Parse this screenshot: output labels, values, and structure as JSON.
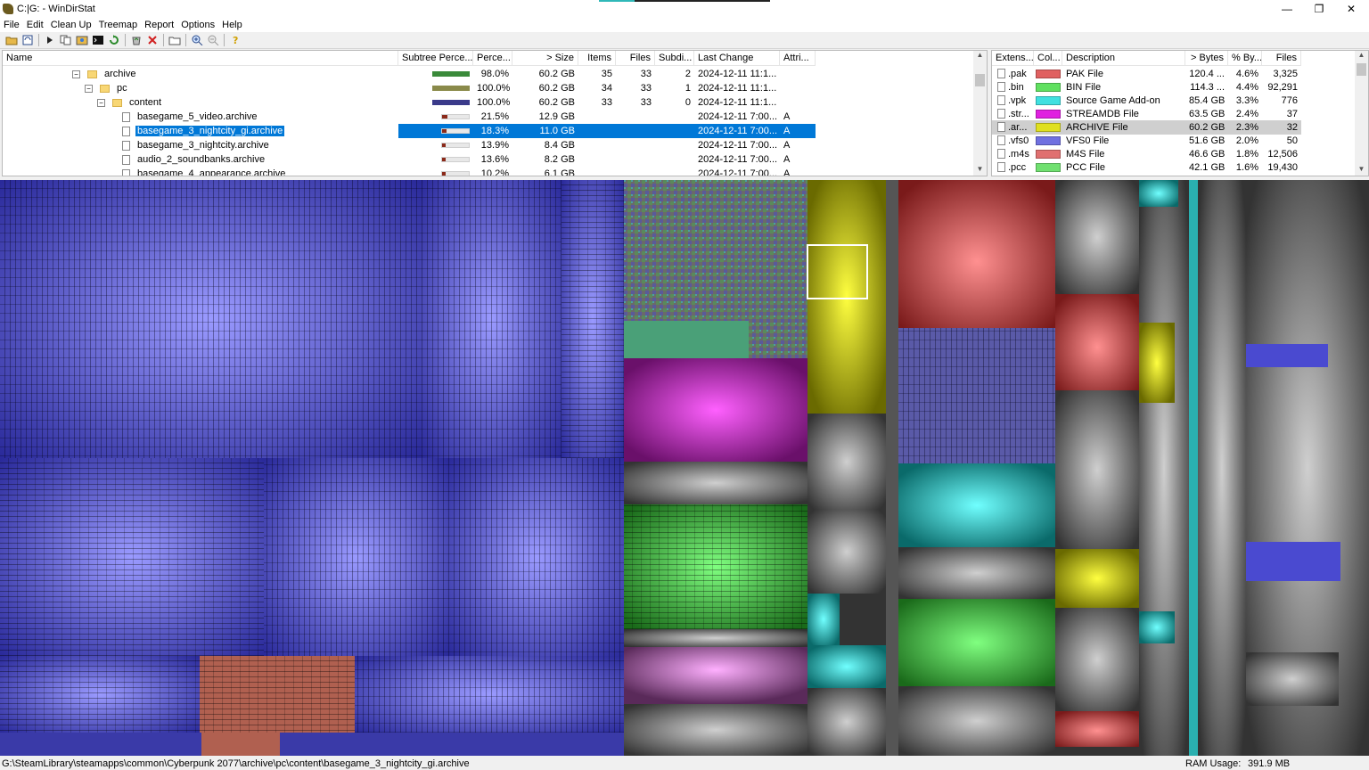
{
  "window": {
    "title": "C:|G: - WinDirStat",
    "minimize": "—",
    "maximize": "❐",
    "close": "✕"
  },
  "menu": [
    "File",
    "Edit",
    "Clean Up",
    "Treemap",
    "Report",
    "Options",
    "Help"
  ],
  "toolbar": {
    "icons": [
      "open-icon",
      "refresh-all-icon",
      "play-icon",
      "copy-path-icon",
      "explorer-icon",
      "command-prompt-icon",
      "refresh-icon",
      "recycle-icon",
      "delete-icon",
      "new-folder-icon",
      "zoom-in-icon",
      "zoom-out-icon",
      "help-icon"
    ]
  },
  "tree": {
    "headers": [
      "Name",
      "Subtree Perce...",
      "Perce...",
      "> Size",
      "Items",
      "Files",
      "Subdi...",
      "Last Change",
      "Attri..."
    ],
    "rows": [
      {
        "name": "archive",
        "type": "folder",
        "expander": "⊟",
        "indent": 0,
        "percent": "98.0%",
        "size": "60.2 GB",
        "items": "35",
        "files": "33",
        "subdirs": "2",
        "changed": "2024-12-11  11:1...",
        "attr": "",
        "bar_color": "#3a8a3a",
        "bar_fill": 1.0
      },
      {
        "name": "pc",
        "type": "folder",
        "expander": "⊟",
        "indent": 1,
        "percent": "100.0%",
        "size": "60.2 GB",
        "items": "34",
        "files": "33",
        "subdirs": "1",
        "changed": "2024-12-11  11:1...",
        "attr": "",
        "bar_color": "#8a8a4a",
        "bar_fill": 1.0
      },
      {
        "name": "content",
        "type": "folder",
        "expander": "⊟",
        "indent": 2,
        "percent": "100.0%",
        "size": "60.2 GB",
        "items": "33",
        "files": "33",
        "subdirs": "0",
        "changed": "2024-12-11  11:1...",
        "attr": "",
        "bar_color": "#3a3a8a",
        "bar_fill": 1.0
      },
      {
        "name": "basegame_5_video.archive",
        "type": "file",
        "expander": "",
        "indent": 3,
        "percent": "21.5%",
        "size": "12.9 GB",
        "items": "",
        "files": "",
        "subdirs": "",
        "changed": "2024-12-11  7:00...",
        "attr": "A",
        "bar_color": "#8b2a1a",
        "bar_fill": 0.215
      },
      {
        "name": "basegame_3_nightcity_gi.archive",
        "type": "file",
        "expander": "",
        "indent": 3,
        "percent": "18.3%",
        "size": "11.0 GB",
        "items": "",
        "files": "",
        "subdirs": "",
        "changed": "2024-12-11  7:00...",
        "attr": "A",
        "bar_color": "#8b2a1a",
        "bar_fill": 0.183,
        "selected": true
      },
      {
        "name": "basegame_3_nightcity.archive",
        "type": "file",
        "expander": "",
        "indent": 3,
        "percent": "13.9%",
        "size": "8.4 GB",
        "items": "",
        "files": "",
        "subdirs": "",
        "changed": "2024-12-11  7:00...",
        "attr": "A",
        "bar_color": "#8b2a1a",
        "bar_fill": 0.139
      },
      {
        "name": "audio_2_soundbanks.archive",
        "type": "file",
        "expander": "",
        "indent": 3,
        "percent": "13.6%",
        "size": "8.2 GB",
        "items": "",
        "files": "",
        "subdirs": "",
        "changed": "2024-12-11  7:00...",
        "attr": "A",
        "bar_color": "#8b2a1a",
        "bar_fill": 0.136
      },
      {
        "name": "basegame_4_appearance.archive",
        "type": "file",
        "expander": "",
        "indent": 3,
        "percent": "10.2%",
        "size": "6.1 GB",
        "items": "",
        "files": "",
        "subdirs": "",
        "changed": "2024-12-11  7:00...",
        "attr": "A",
        "bar_color": "#8b2a1a",
        "bar_fill": 0.102
      }
    ]
  },
  "extensions": {
    "headers": [
      "Extens...",
      "Col...",
      "Description",
      "> Bytes",
      "% By...",
      "Files"
    ],
    "rows": [
      {
        "ext": ".pak",
        "color": "#e06060",
        "desc": "PAK File",
        "bytes": "120.4 ...",
        "pct": "4.6%",
        "files": "3,325"
      },
      {
        "ext": ".bin",
        "color": "#60e060",
        "desc": "BIN File",
        "bytes": "114.3 ...",
        "pct": "4.4%",
        "files": "92,291"
      },
      {
        "ext": ".vpk",
        "color": "#40e0e0",
        "desc": "Source Game Add-on",
        "bytes": "85.4 GB",
        "pct": "3.3%",
        "files": "776"
      },
      {
        "ext": ".str...",
        "color": "#e020e0",
        "desc": "STREAMDB File",
        "bytes": "63.5 GB",
        "pct": "2.4%",
        "files": "37"
      },
      {
        "ext": ".ar...",
        "color": "#e0e020",
        "desc": "ARCHIVE File",
        "bytes": "60.2 GB",
        "pct": "2.3%",
        "files": "32",
        "highlighted": true
      },
      {
        "ext": ".vfs0",
        "color": "#7070e0",
        "desc": "VFS0 File",
        "bytes": "51.6 GB",
        "pct": "2.0%",
        "files": "50"
      },
      {
        "ext": ".m4s",
        "color": "#e07070",
        "desc": "M4S File",
        "bytes": "46.6 GB",
        "pct": "1.8%",
        "files": "12,506"
      },
      {
        "ext": ".pcc",
        "color": "#70e070",
        "desc": "PCC File",
        "bytes": "42.1 GB",
        "pct": "1.6%",
        "files": "19,430"
      }
    ]
  },
  "status": {
    "path": "G:\\SteamLibrary\\steamapps\\common\\Cyberpunk 2077\\archive\\pc\\content\\basegame_3_nightcity_gi.archive",
    "ram_label": "RAM Usage:",
    "ram_value": "391.9 MB"
  }
}
